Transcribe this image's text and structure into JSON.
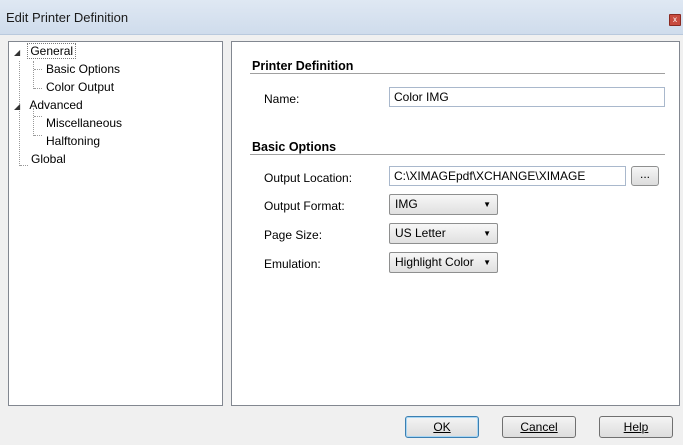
{
  "window": {
    "title": "Edit Printer Definition",
    "close_glyph": "x"
  },
  "tree": {
    "items": [
      {
        "label": "General",
        "expander": "◢"
      },
      {
        "label": "Basic Options"
      },
      {
        "label": "Color Output"
      },
      {
        "label": "Advanced",
        "expander": "◢"
      },
      {
        "label": "Miscellaneous"
      },
      {
        "label": "Halftoning"
      },
      {
        "label": "Global"
      }
    ]
  },
  "printer_definition": {
    "section_title": "Printer Definition",
    "name_label": "Name:",
    "name_value": "Color IMG"
  },
  "basic_options": {
    "section_title": "Basic Options",
    "output_location_label": "Output Location:",
    "output_location_value": "C:\\XIMAGEpdf\\XCHANGE\\XIMAGE",
    "browse_label": "...",
    "output_format_label": "Output Format:",
    "output_format_value": "IMG",
    "page_size_label": "Page Size:",
    "page_size_value": "US Letter",
    "emulation_label": "Emulation:",
    "emulation_value": "Highlight Color"
  },
  "buttons": {
    "ok": "OK",
    "cancel": "Cancel",
    "help": "Help"
  },
  "icons": {
    "dropdown": "chevron-down-icon",
    "close": "close-icon"
  }
}
